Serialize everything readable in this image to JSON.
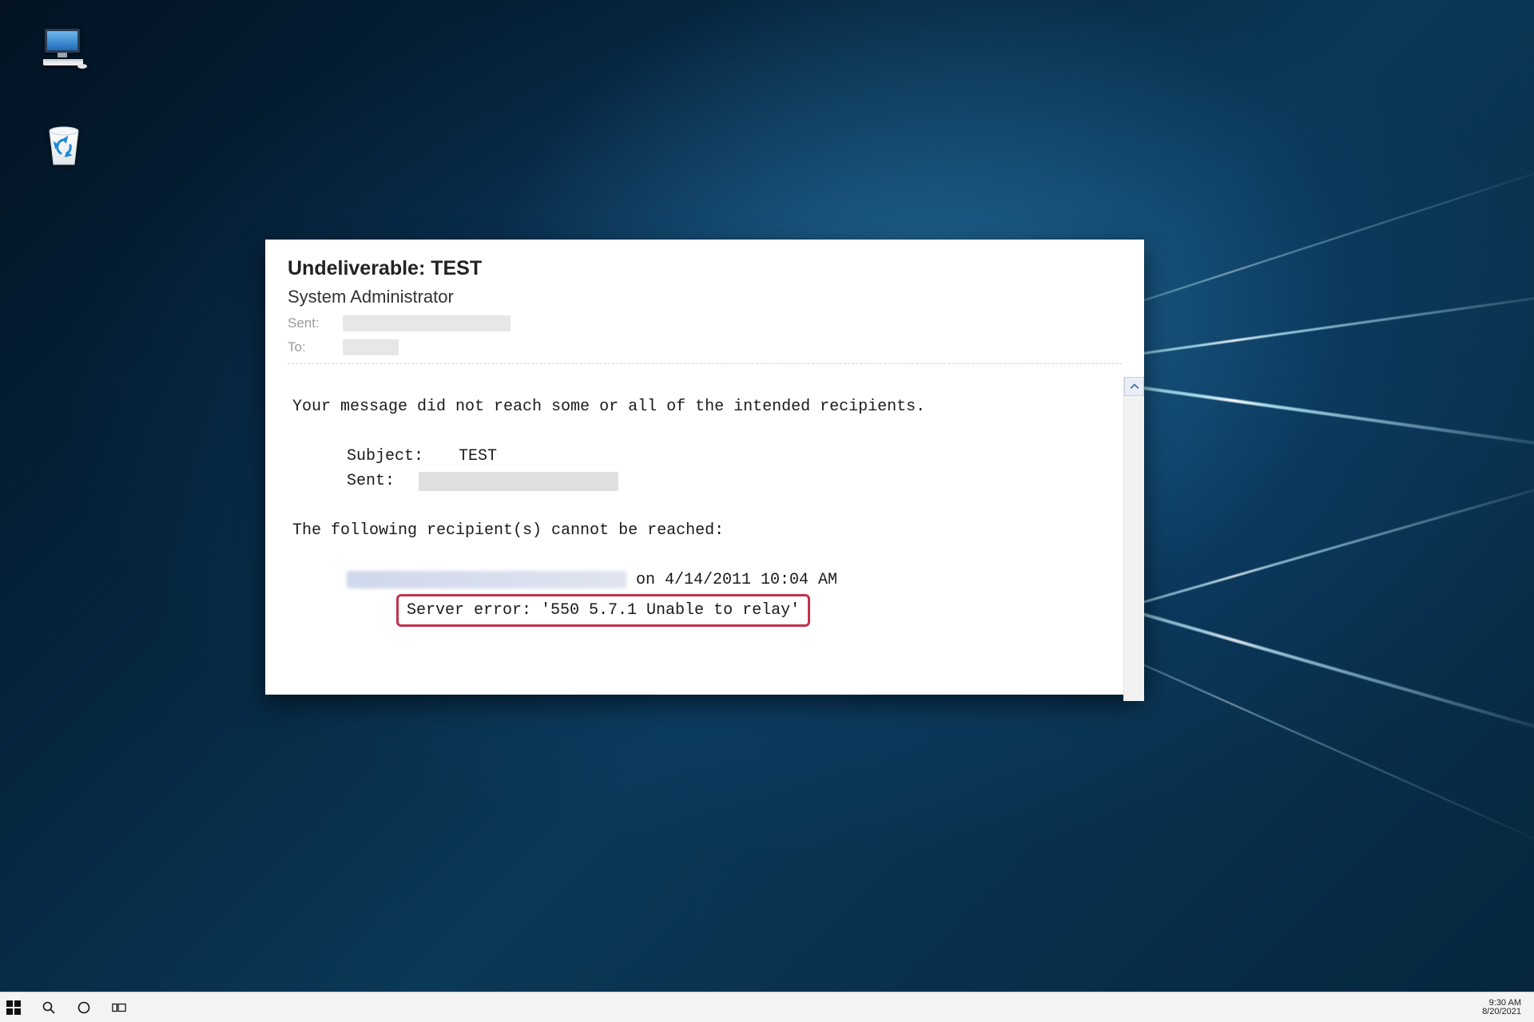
{
  "email": {
    "title": "Undeliverable: TEST",
    "from": "System Administrator",
    "meta": {
      "sent_label": "Sent:",
      "to_label": "To:"
    },
    "body": {
      "line1": "Your message did not reach some or all of the intended recipients.",
      "subject_label": "Subject:",
      "subject_value": "TEST",
      "sent_label": "Sent:",
      "line2": "The following recipient(s) cannot be reached:",
      "recip_suffix": " on 4/14/2011 10:04 AM",
      "error_text": "Server error: '550 5.7.1 Unable to relay'"
    }
  },
  "taskbar": {
    "time": "9:30 AM",
    "date": "8/20/2021"
  }
}
